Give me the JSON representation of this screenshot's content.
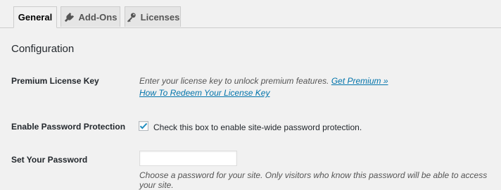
{
  "tabs": [
    {
      "label": "General",
      "icon": "none"
    },
    {
      "label": "Add-Ons",
      "icon": "plug-icon"
    },
    {
      "label": "Licenses",
      "icon": "key-icon"
    }
  ],
  "active_tab": "General",
  "section": {
    "title": "Configuration"
  },
  "license": {
    "label": "Premium License Key",
    "description": "Enter your license key to unlock premium features.",
    "premium_link": "Get Premium »",
    "redeem_link": "How To Redeem Your License Key"
  },
  "protection": {
    "label": "Enable Password Protection",
    "checked": true,
    "checkbox_text": "Check this box to enable site-wide password protection."
  },
  "password": {
    "label": "Set Your Password",
    "value": "",
    "description": "Choose a password for your site. Only visitors who know this password will be able to access your site."
  },
  "colors": {
    "link": "#0073aa",
    "checkmark": "#1e8cbe",
    "background": "#f1f1f1"
  }
}
